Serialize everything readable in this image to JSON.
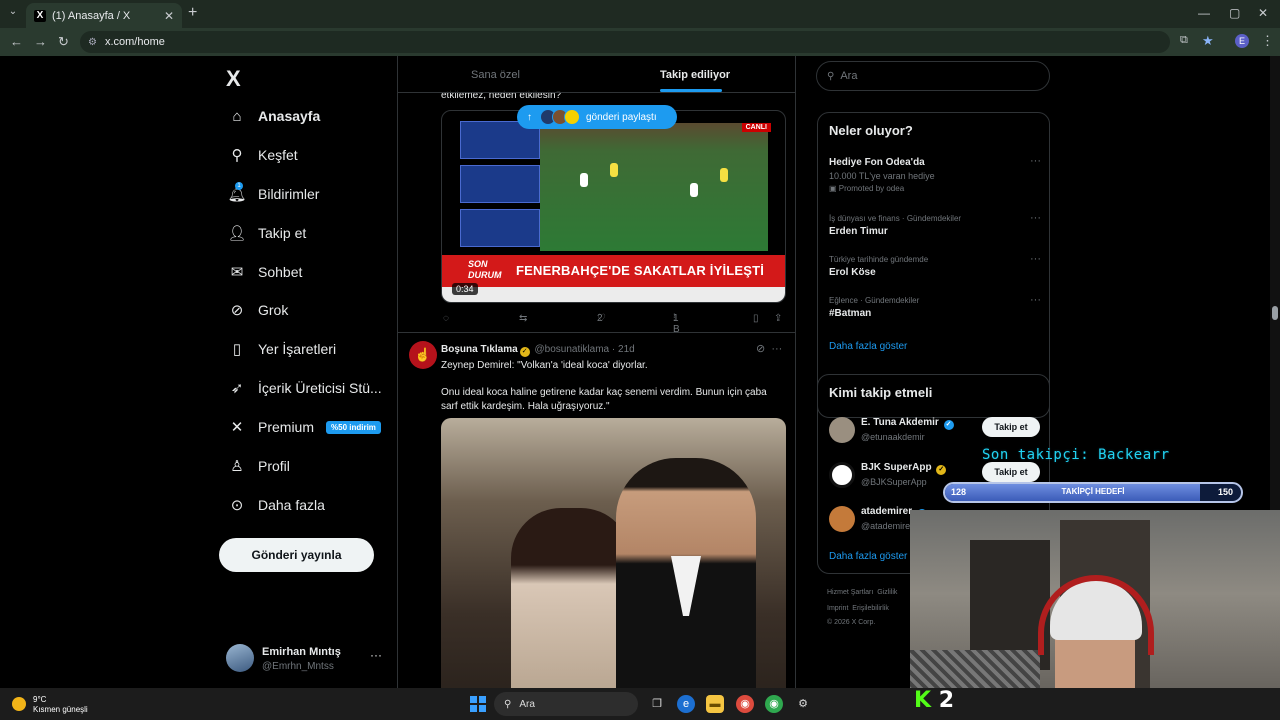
{
  "browser": {
    "tab_title": "(1) Anasayfa / X",
    "url": "x.com/home",
    "profile_initial": "E"
  },
  "nav": {
    "items": [
      {
        "label": "Anasayfa",
        "icon": "home-icon"
      },
      {
        "label": "Keşfet",
        "icon": "search-icon"
      },
      {
        "label": "Bildirimler",
        "icon": "bell-icon",
        "badge": "1"
      },
      {
        "label": "Takip et",
        "icon": "add-user-icon"
      },
      {
        "label": "Sohbet",
        "icon": "mail-icon"
      },
      {
        "label": "Grok",
        "icon": "grok-icon"
      },
      {
        "label": "Yer İşaretleri",
        "icon": "bookmark-icon"
      },
      {
        "label": "İçerik Üreticisi Stü...",
        "icon": "rocket-icon"
      },
      {
        "label": "Premium",
        "icon": "x-icon",
        "promo": "%50 indirim"
      },
      {
        "label": "Profil",
        "icon": "person-icon"
      },
      {
        "label": "Daha fazla",
        "icon": "more-circle-icon"
      }
    ],
    "post_button": "Gönderi yayınla",
    "account": {
      "name": "Emirhan Mıntış",
      "handle": "@Emrhn_Mntss"
    }
  },
  "timeline": {
    "tabs": [
      "Sana özel",
      "Takip ediliyor"
    ],
    "active_tab": "Takip ediliyor",
    "snippet": "etkilemez, neden etkilesin?",
    "share_pill": "gönderi paylaştı",
    "tweet1": {
      "video_badge": "CANLI",
      "son_durum": "SON DURUM",
      "headline": "FENERBAHÇE'DE SAKATLAR İYİLEŞTİ",
      "duration": "0:34",
      "likes": "2",
      "views": "1 B"
    },
    "tweet2": {
      "name": "Boşuna Tıklama",
      "handle": "@bosunatiklama",
      "time": "21d",
      "text": "Zeynep Demirel: \"Volkan'a 'ideal koca' diyorlar.\n\nOnu ideal koca haline getirene kadar kaç senemi verdim. Bunun için çaba sarf ettik kardeşim. Hala uğraşıyoruz.\""
    }
  },
  "sidebar": {
    "search_placeholder": "Ara",
    "trends_title": "Neler oluyor?",
    "trends": [
      {
        "meta": "",
        "name": "Hediye Fon Odea'da",
        "sub": "10.000 TL'ye varan hediye",
        "promoted": "Promoted by odea"
      },
      {
        "meta": "İş dünyası ve finans · Gündemdekiler",
        "name": "Erden Timur",
        "sub": "",
        "promoted": ""
      },
      {
        "meta": "Türkiye tarihinde gündemde",
        "name": "Erol Köse",
        "sub": "",
        "promoted": ""
      },
      {
        "meta": "Eğlence · Gündemdekiler",
        "name": "#Batman",
        "sub": "",
        "promoted": ""
      }
    ],
    "show_more": "Daha fazla göster",
    "who_title": "Kimi takip etmeli",
    "who": [
      {
        "name": "E. Tuna Akdemir",
        "handle": "@etunaakdemir"
      },
      {
        "name": "BJK SuperApp",
        "handle": "@BJKSuperApp"
      },
      {
        "name": "atademirer",
        "handle": "@atademirer"
      }
    ],
    "follow_label": "Takip et",
    "footer": [
      "Hizmet Şartları",
      "Gizlilik",
      "Imprint",
      "Erişilebilirlik",
      "© 2026 X Corp."
    ]
  },
  "overlay": {
    "last_follower": "Son takipçi: Backearr",
    "goal_min": "128",
    "goal_max": "150",
    "goal_label": "TAKİPÇİ HEDEFİ",
    "goal_progress": 0.86,
    "kick_count": "2"
  },
  "taskbar": {
    "temp": "9°C",
    "weather": "Kısmen güneşli",
    "search": "Ara"
  }
}
